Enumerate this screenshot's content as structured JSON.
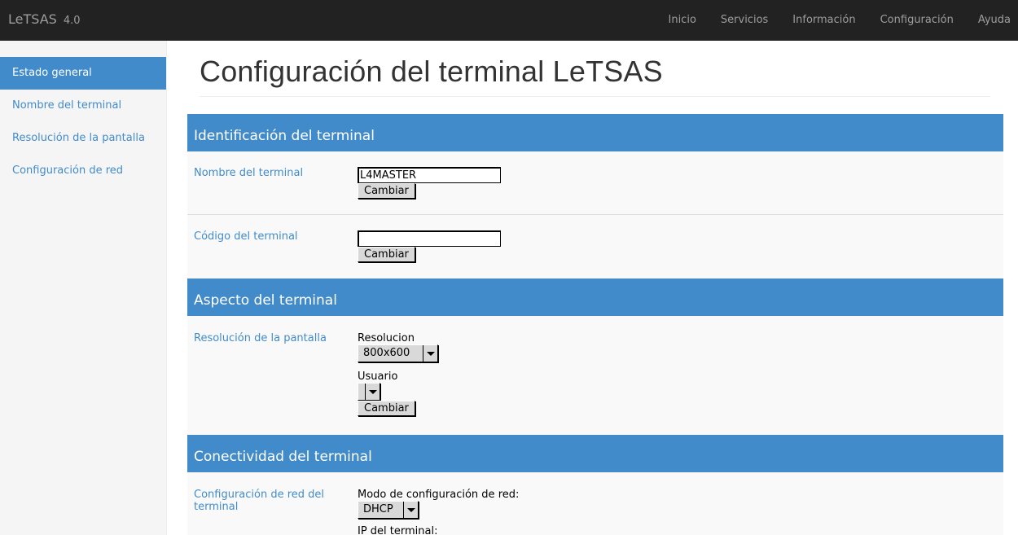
{
  "navbar": {
    "brand": "LeTSAS",
    "version": "4.0",
    "items": [
      "Inicio",
      "Servicios",
      "Información",
      "Configuración",
      "Ayuda"
    ]
  },
  "sidebar": {
    "items": [
      {
        "label": "Estado general",
        "active": true
      },
      {
        "label": "Nombre del terminal",
        "active": false
      },
      {
        "label": "Resolución de la pantalla",
        "active": false
      },
      {
        "label": "Configuración de red",
        "active": false
      }
    ]
  },
  "page": {
    "title": "Configuración del terminal LeTSAS"
  },
  "sections": {
    "identification": {
      "heading": "Identificación del terminal",
      "name": {
        "label": "Nombre del terminal",
        "value": "L4MASTER",
        "button": "Cambiar"
      },
      "code": {
        "label": "Código del terminal",
        "value": "",
        "button": "Cambiar"
      }
    },
    "appearance": {
      "heading": "Aspecto del terminal",
      "resolution": {
        "label": "Resolución de la pantalla",
        "resolution_caption": "Resolucion",
        "resolution_value": "800x600",
        "user_caption": "Usuario",
        "user_value": "",
        "button": "Cambiar"
      }
    },
    "connectivity": {
      "heading": "Conectividad del terminal",
      "network": {
        "label": "Configuración de red del terminal",
        "mode_caption": "Modo de configuración de red:",
        "mode_value": "DHCP",
        "ip_caption": "IP del terminal:"
      }
    }
  },
  "colors": {
    "navbar": "#222222",
    "accent": "#428bca",
    "sidebar": "#f5f5f5",
    "row": "#f9f9f9"
  }
}
